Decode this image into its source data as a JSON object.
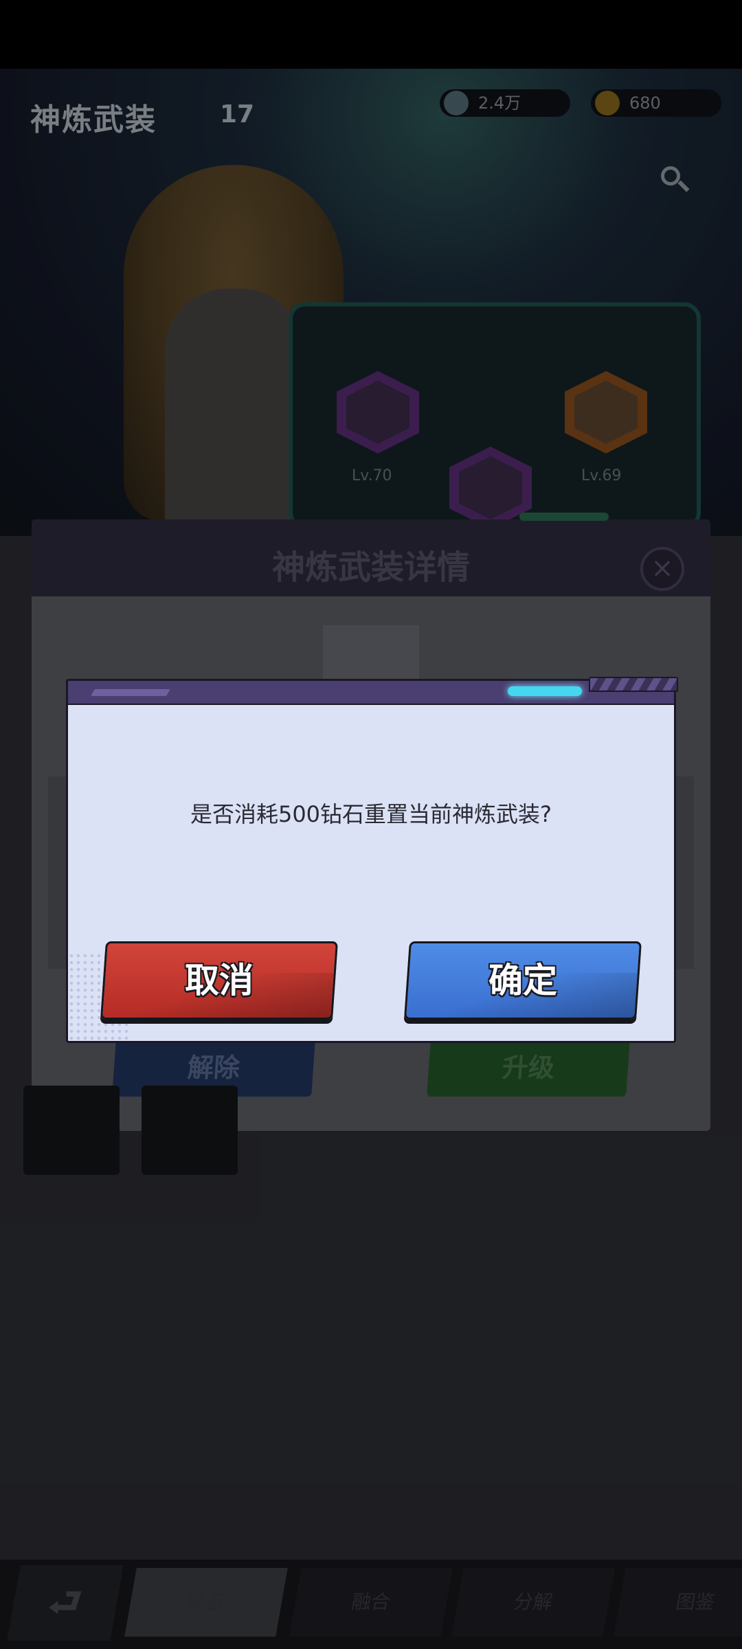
{
  "background": {
    "title": "神炼武装",
    "title_badge": "17",
    "resources": [
      {
        "icon": "gem-icon",
        "value": "2.4万"
      },
      {
        "icon": "gold-coin-icon",
        "value": "680"
      }
    ],
    "equipment_levels": [
      "Lv.70",
      "Lv.69"
    ],
    "detail_title": "神炼武装详情",
    "buttons": {
      "unequip": "解除",
      "upgrade": "升级"
    },
    "nav_tabs": [
      "装备",
      "融合",
      "分解",
      "图鉴"
    ]
  },
  "dialog": {
    "message": "是否消耗500钻石重置当前神炼武装?",
    "cancel_label": "取消",
    "confirm_label": "确定"
  },
  "colors": {
    "dialog_bg": "#dce2f5",
    "dialog_header": "#4b3e70",
    "cancel_red": "#c2352e",
    "confirm_blue": "#4a82e0",
    "accent_cyan": "#45d7f0"
  }
}
